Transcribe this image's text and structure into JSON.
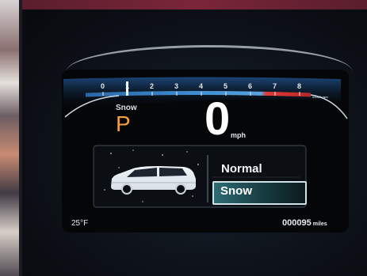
{
  "tachometer": {
    "ticks": [
      "0",
      "1",
      "2",
      "3",
      "4",
      "5",
      "6",
      "7",
      "8"
    ],
    "unit": "x1000 rpm"
  },
  "gear": {
    "label": "Snow",
    "value": "P"
  },
  "speed": {
    "value": "0",
    "unit": "mph"
  },
  "drive_modes": {
    "normal": "Normal",
    "snow": "Snow",
    "selected": "Snow"
  },
  "temperature": "25°F",
  "odometer": {
    "value": "000095",
    "unit": "miles"
  },
  "colors": {
    "accent": "#4a9fd6",
    "redline": "#e23b3b",
    "gear": "#f2a042",
    "selected_mode": "#2f6b74"
  }
}
